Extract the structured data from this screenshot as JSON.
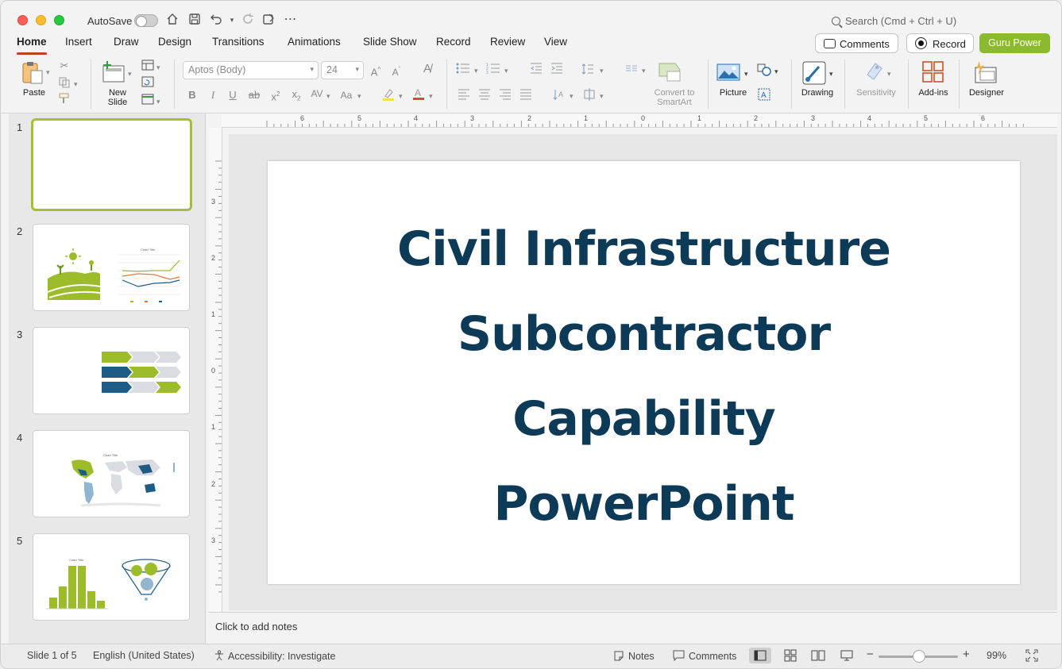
{
  "titlebar": {
    "autosave_label": "AutoSave",
    "search_placeholder": "Search (Cmd + Ctrl + U)"
  },
  "tabs": [
    {
      "label": "Home",
      "active": true
    },
    {
      "label": "Insert"
    },
    {
      "label": "Draw"
    },
    {
      "label": "Design"
    },
    {
      "label": "Transitions"
    },
    {
      "label": "Animations"
    },
    {
      "label": "Slide Show"
    },
    {
      "label": "Record"
    },
    {
      "label": "Review"
    },
    {
      "label": "View"
    }
  ],
  "header_buttons": {
    "comments": "Comments",
    "record": "Record",
    "guru": "Guru Power",
    "guru_color": "#8cba2e"
  },
  "ribbon": {
    "paste": "Paste",
    "new_slide": "New\nSlide",
    "font_name": "Aptos (Body)",
    "font_size": "24",
    "convert_smartart": "Convert to\nSmartArt",
    "picture": "Picture",
    "drawing": "Drawing",
    "sensitivity": "Sensitivity",
    "addins": "Add-ins",
    "designer": "Designer"
  },
  "slides": [
    {
      "number": "1",
      "selected": true
    },
    {
      "number": "2"
    },
    {
      "number": "3"
    },
    {
      "number": "4"
    },
    {
      "number": "5"
    }
  ],
  "ruler": {
    "h_ticks": [
      "6",
      "5",
      "4",
      "3",
      "2",
      "1",
      "0",
      "1",
      "2",
      "3",
      "4",
      "5",
      "6"
    ],
    "v_ticks": [
      "3",
      "2",
      "1",
      "0",
      "1",
      "2",
      "3"
    ]
  },
  "slide": {
    "title_lines": [
      "Civil Infrastructure",
      "Subcontractor",
      "Capability",
      "PowerPoint"
    ],
    "title_color": "#0c3a57"
  },
  "notes_placeholder": "Click to add notes",
  "statusbar": {
    "slide_info": "Slide 1 of 5",
    "language": "English (United States)",
    "accessibility": "Accessibility: Investigate",
    "notes": "Notes",
    "comments": "Comments",
    "zoom": "99%"
  },
  "accent": "#a8bf34"
}
